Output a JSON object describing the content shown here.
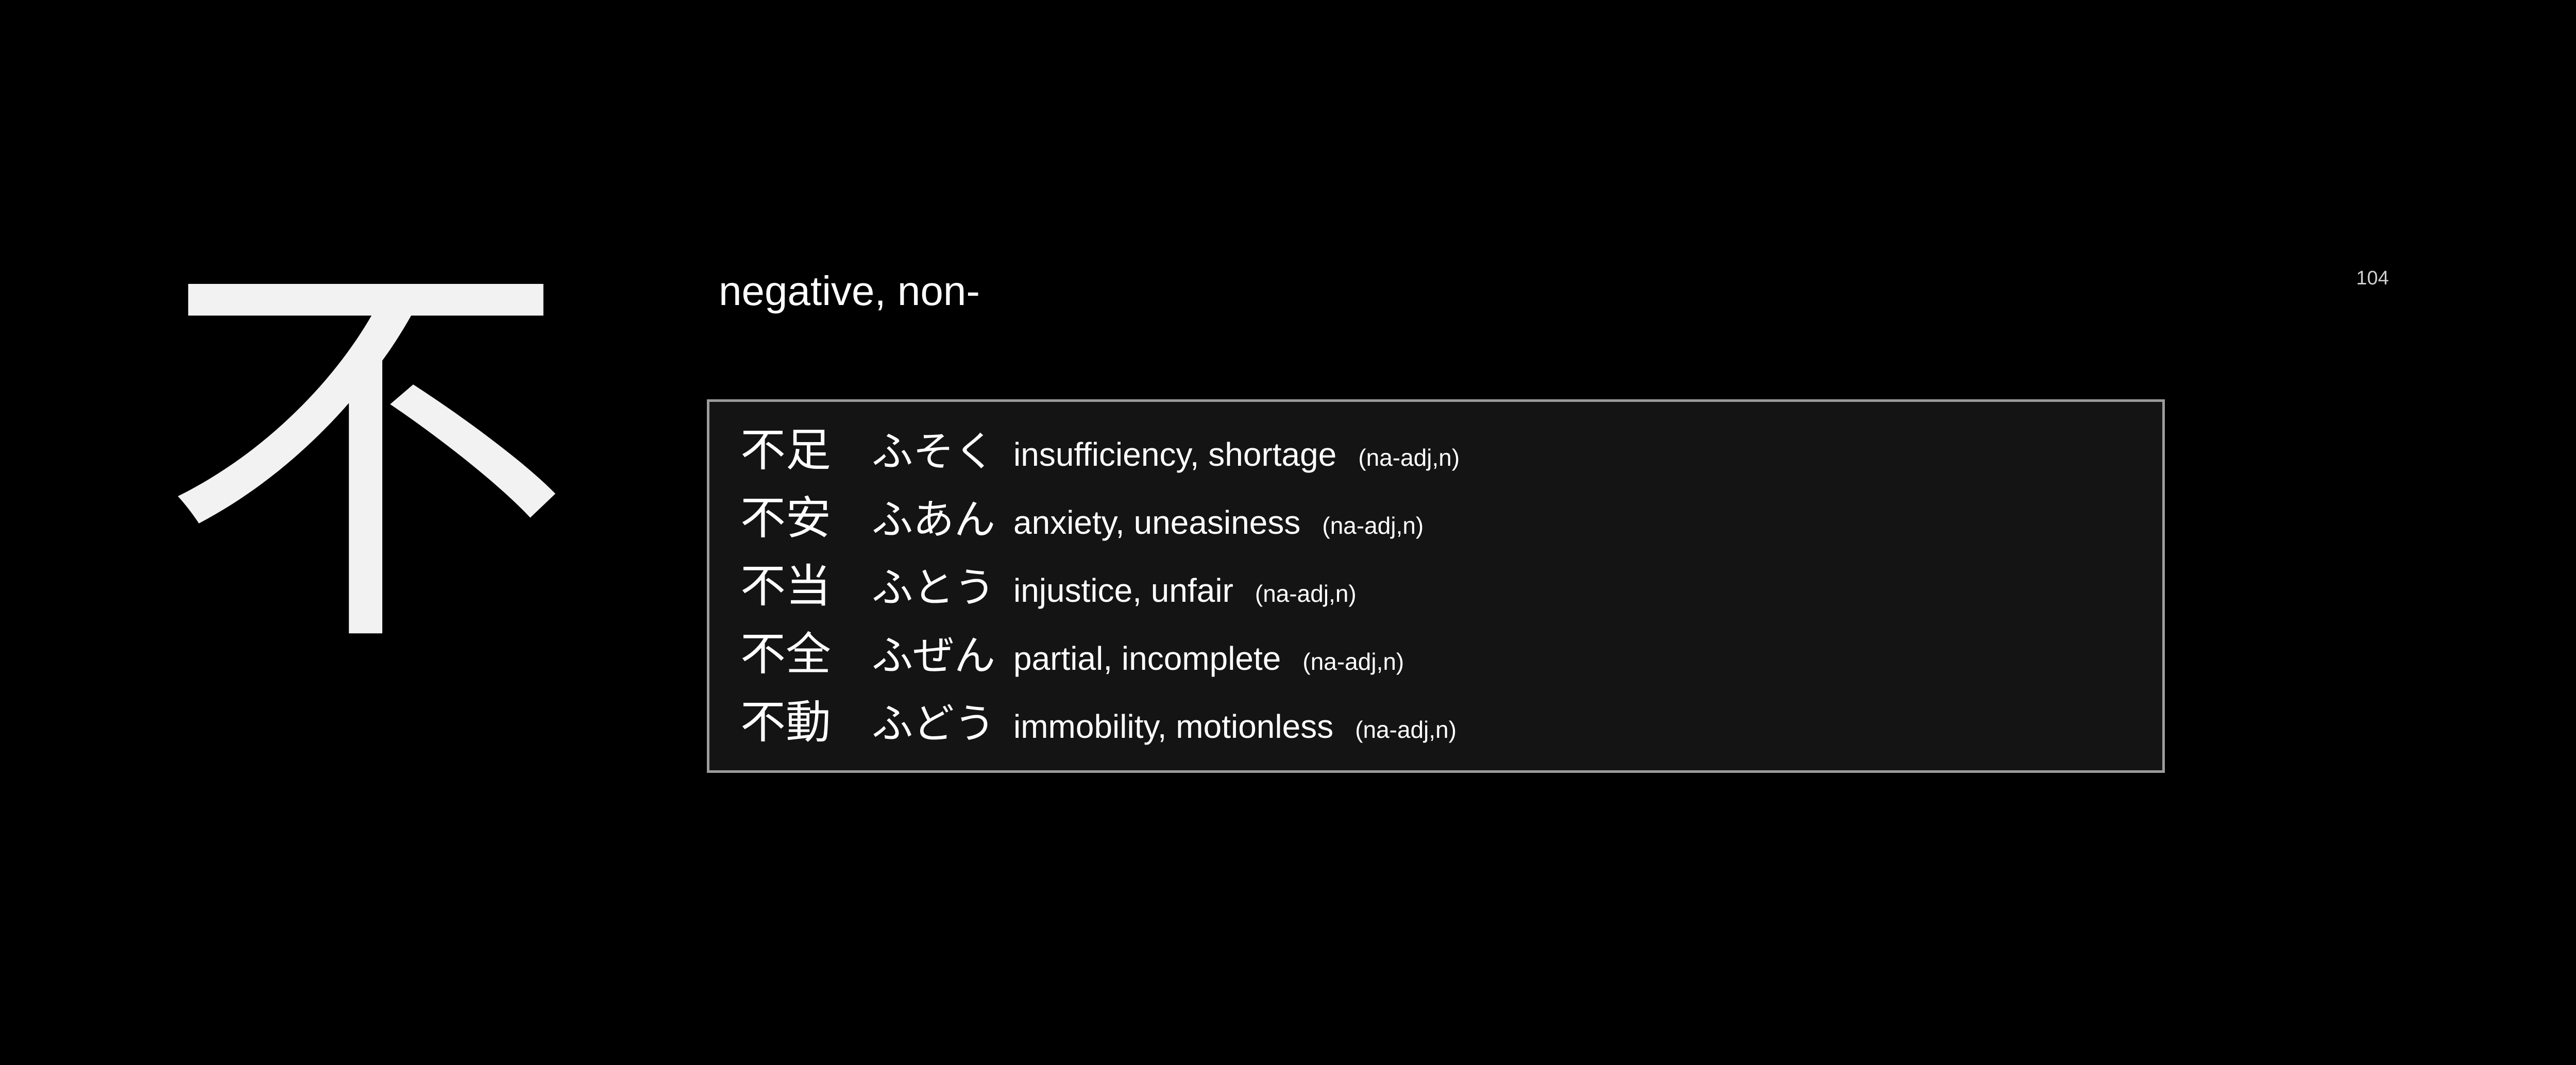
{
  "card": {
    "kanji": "不",
    "meaning": "negative, non-",
    "page_number": "104"
  },
  "vocab": [
    {
      "word": "不足",
      "reading": "ふそく",
      "gloss": "insufficiency, shortage",
      "pos": "(na-adj,n)"
    },
    {
      "word": "不安",
      "reading": "ふあん",
      "gloss": "anxiety, uneasiness",
      "pos": "(na-adj,n)"
    },
    {
      "word": "不当",
      "reading": "ふとう",
      "gloss": "injustice, unfair",
      "pos": "(na-adj,n)"
    },
    {
      "word": "不全",
      "reading": "ふぜん",
      "gloss": "partial, incomplete",
      "pos": "(na-adj,n)"
    },
    {
      "word": "不動",
      "reading": "ふどう",
      "gloss": "immobility, motionless",
      "pos": "(na-adj,n)"
    }
  ],
  "colors": {
    "background": "#000000",
    "text": "#ffffff",
    "box_border": "#9c9c9c",
    "box_background": "#141414"
  }
}
